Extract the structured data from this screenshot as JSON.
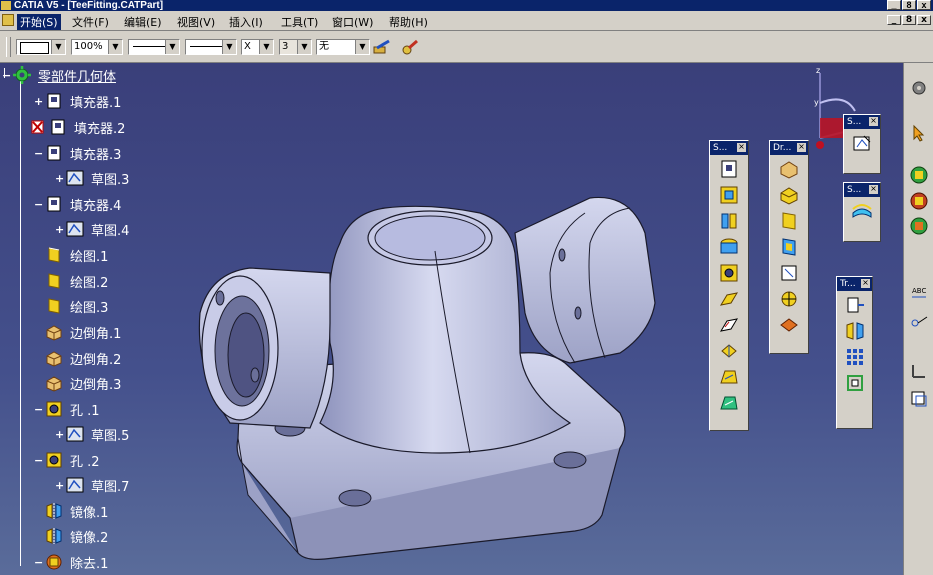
{
  "window": {
    "title": "CATIA V5 - [TeeFitting.CATPart]",
    "controls": [
      "_",
      "8",
      "x"
    ],
    "mdi_controls": [
      "_",
      "8",
      "x"
    ]
  },
  "menu": {
    "items": [
      "开始(S)",
      "文件(F)",
      "编辑(E)",
      "视图(V)",
      "插入(I)",
      "工具(T)",
      "窗口(W)",
      "帮助(H)"
    ]
  },
  "toolbar": {
    "zoom_value": "100%",
    "layer_value": "3",
    "line_type_value": "X",
    "filter_value": "无"
  },
  "tree": {
    "root": "零部件几何体",
    "nodes": [
      {
        "label": "填充器.1",
        "icon": "pad-icon"
      },
      {
        "label": "填充器.2",
        "icon": "pad-error-icon"
      },
      {
        "label": "填充器.3",
        "icon": "pad-icon"
      },
      {
        "label": "草图.3",
        "icon": "sketch-icon"
      },
      {
        "label": "填充器.4",
        "icon": "pad-icon"
      },
      {
        "label": "草图.4",
        "icon": "sketch-icon"
      },
      {
        "label": "绘图.1",
        "icon": "draft-icon"
      },
      {
        "label": "绘图.2",
        "icon": "draft-icon"
      },
      {
        "label": "绘图.3",
        "icon": "draft-icon"
      },
      {
        "label": "边倒角.1",
        "icon": "fillet-icon"
      },
      {
        "label": "边倒角.2",
        "icon": "fillet-icon"
      },
      {
        "label": "边倒角.3",
        "icon": "fillet-icon"
      },
      {
        "label": "孔 .1",
        "icon": "hole-icon"
      },
      {
        "label": "草图.5",
        "icon": "sketch-icon"
      },
      {
        "label": "孔 .2",
        "icon": "hole-icon"
      },
      {
        "label": "草图.7",
        "icon": "sketch-icon"
      },
      {
        "label": "镜像.1",
        "icon": "mirror-icon"
      },
      {
        "label": "镜像.2",
        "icon": "mirror-icon"
      },
      {
        "label": "除去.1",
        "icon": "remove-icon"
      }
    ]
  },
  "floating_toolbars": [
    {
      "title": "S...",
      "icons": [
        "pad-icon",
        "pocket-icon",
        "shaft-icon",
        "groove-icon",
        "hole-icon",
        "rib-icon",
        "slot-icon",
        "stiffener-icon",
        "loft-icon",
        "removed-loft-icon"
      ]
    },
    {
      "title": "Dr...",
      "icons": [
        "fillet-icon",
        "chamfer-icon",
        "draft-icon",
        "shell-icon",
        "thickness-icon",
        "thread-icon",
        "remove-face-icon"
      ]
    },
    {
      "title": "S...",
      "icons": [
        "sketch-icon"
      ]
    },
    {
      "title": "S...",
      "icons": [
        "surface-icon"
      ]
    },
    {
      "title": "Tr...",
      "icons": [
        "translate-icon",
        "mirror-icon",
        "pattern-icon",
        "scale-icon"
      ]
    }
  ],
  "compass": {
    "axes": [
      "z",
      "y",
      "x"
    ]
  },
  "colors": {
    "titlebar": "#0a246a",
    "chrome": "#d4d0c8",
    "viewport": "#3f4d80",
    "part": "#b9bedb"
  }
}
